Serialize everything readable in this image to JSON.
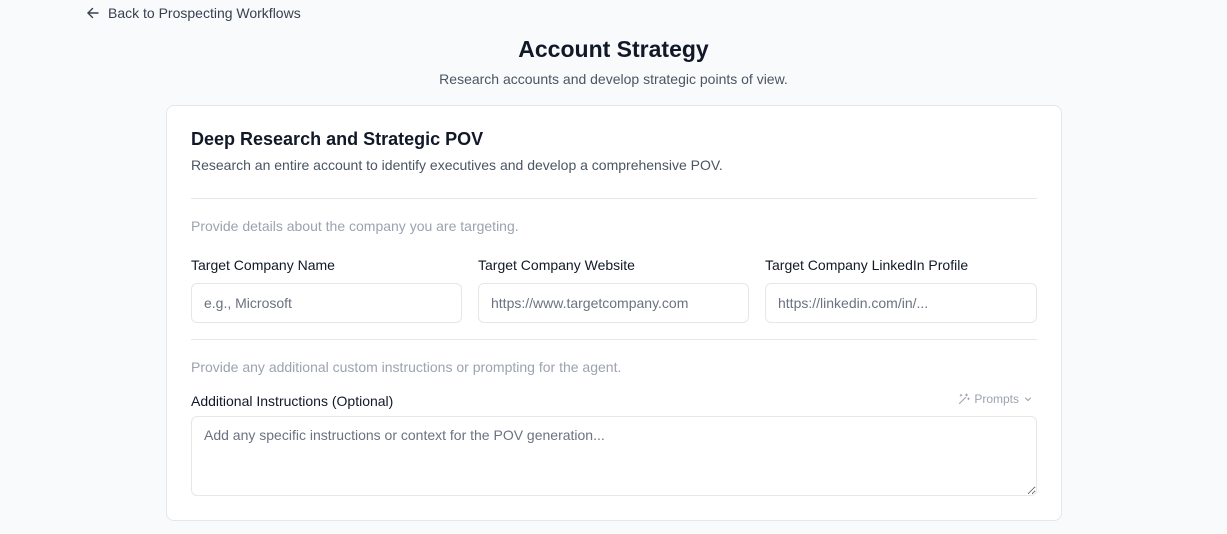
{
  "nav": {
    "back_label": "Back to Prospecting Workflows"
  },
  "header": {
    "title": "Account Strategy",
    "subtitle": "Research accounts and develop strategic points of view."
  },
  "card": {
    "title": "Deep Research and Strategic POV",
    "description": "Research an entire account to identify executives and develop a comprehensive POV.",
    "company_hint": "Provide details about the company you are targeting.",
    "fields": [
      {
        "label": "Target Company Name",
        "placeholder": "e.g., Microsoft",
        "value": ""
      },
      {
        "label": "Target Company Website",
        "placeholder": "https://www.targetcompany.com",
        "value": ""
      },
      {
        "label": "Target Company LinkedIn Profile",
        "placeholder": "https://linkedin.com/in/...",
        "value": ""
      }
    ],
    "instructions_hint": "Provide any additional custom instructions or prompting for the agent.",
    "instructions": {
      "label": "Additional Instructions (Optional)",
      "placeholder": "Add any specific instructions or context for the POV generation...",
      "value": ""
    },
    "prompts_label": "Prompts"
  },
  "colors": {
    "background": "#f9fafb",
    "card": "#ffffff",
    "border": "#e5e7eb",
    "text_primary": "#111827",
    "text_secondary": "#4b5563",
    "text_muted": "#9ca3af"
  },
  "icons": {
    "back": "arrow-left-icon",
    "prompts": "magic-wand-icon",
    "prompts_caret": "chevron-down-icon"
  }
}
